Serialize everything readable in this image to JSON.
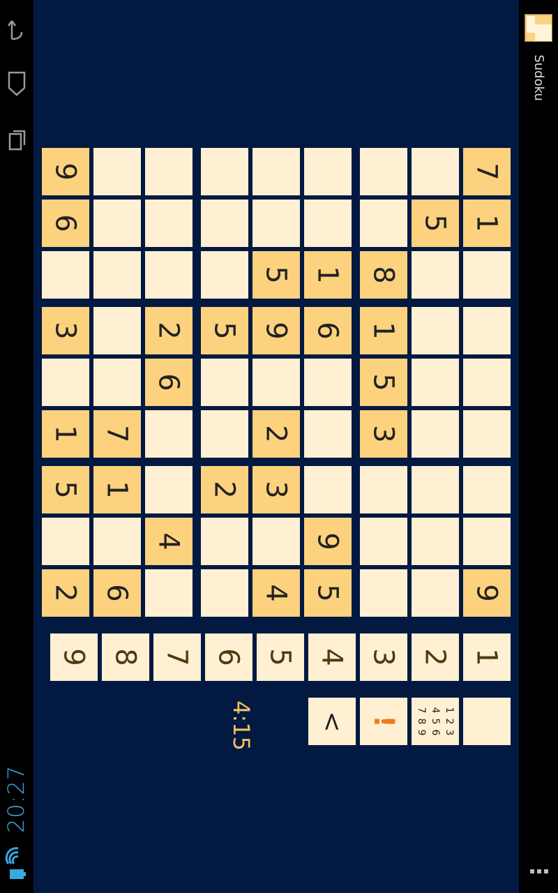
{
  "status_bar": {
    "time": "20:27"
  },
  "action_bar": {
    "title": "Sudoku",
    "icons": [
      "app-grid-icon",
      "overflow-menu-icon"
    ]
  },
  "nav_bar": {
    "icons": [
      "back-icon",
      "home-icon",
      "recent-apps-icon"
    ]
  },
  "board": {
    "rows": [
      [
        "9",
        "6",
        "",
        "3",
        "",
        "1",
        "5",
        "",
        "2"
      ],
      [
        "",
        "",
        "",
        "",
        "",
        "7",
        "1",
        "",
        "6"
      ],
      [
        "",
        "",
        "",
        "2",
        "6",
        "",
        "",
        "4",
        ""
      ],
      [
        "",
        "",
        "",
        "5",
        "",
        "",
        "2",
        "",
        ""
      ],
      [
        "",
        "",
        "5",
        "9",
        "",
        "2",
        "3",
        "",
        "4"
      ],
      [
        "",
        "",
        "1",
        "6",
        "",
        "",
        "",
        "9",
        "5"
      ],
      [
        "",
        "",
        "8",
        "1",
        "5",
        "3",
        "",
        "",
        ""
      ],
      [
        "",
        "5",
        "",
        "",
        "",
        "",
        "",
        "",
        ""
      ],
      [
        "7",
        "1",
        "",
        "",
        "",
        "",
        "",
        "",
        "9"
      ]
    ]
  },
  "number_pad": [
    "9",
    "8",
    "7",
    "6",
    "5",
    "4",
    "3",
    "2",
    "1"
  ],
  "tools": {
    "undo_label": "<",
    "hint_label": "!",
    "notes_digits": [
      "1",
      "2",
      "3",
      "4",
      "5",
      "6",
      "7",
      "8",
      "9"
    ],
    "blank_label": ""
  },
  "timer": "4:15",
  "colors": {
    "background": "#021942",
    "given_cell": "#fcd27e",
    "empty_cell": "#fff0d3",
    "timer": "#f2c25f",
    "hint": "#f07a1a"
  }
}
